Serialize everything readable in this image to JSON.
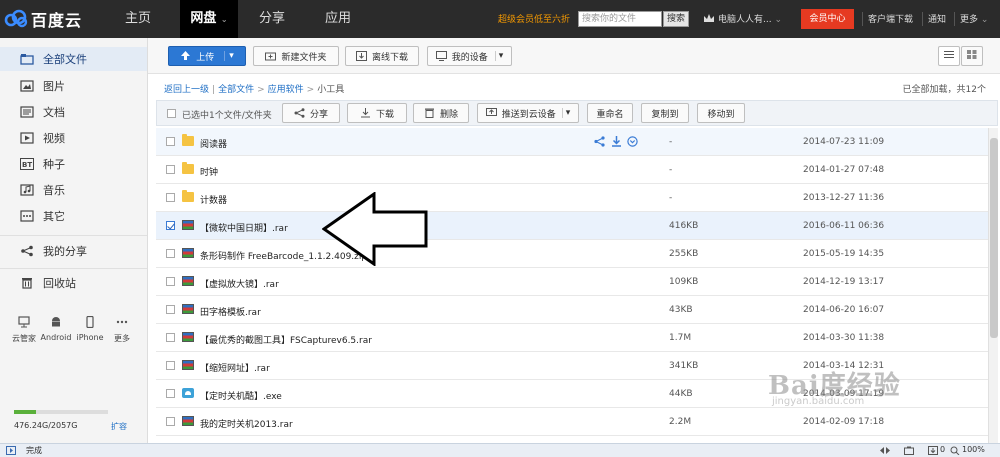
{
  "header": {
    "logo_text": "百度云",
    "nav": [
      {
        "label": "主页"
      },
      {
        "label": "网盘"
      },
      {
        "label": "分享"
      },
      {
        "label": "应用"
      }
    ],
    "promo_text": "超级会员低至六折",
    "search_placeholder": "搜索你的文件",
    "search_button": "搜索",
    "user_name": "电脑人人有...",
    "vip_button": "会员中心",
    "links": [
      "客户端下载",
      "通知",
      "更多"
    ]
  },
  "sidebar": {
    "items": [
      {
        "label": "全部文件",
        "icon": "folder-icon"
      },
      {
        "label": "图片",
        "icon": "image-icon"
      },
      {
        "label": "文档",
        "icon": "document-icon"
      },
      {
        "label": "视频",
        "icon": "video-icon"
      },
      {
        "label": "种子",
        "icon": "torrent-icon"
      },
      {
        "label": "音乐",
        "icon": "music-icon"
      },
      {
        "label": "其它",
        "icon": "more-icon"
      },
      {
        "label": "我的分享",
        "icon": "share-icon"
      },
      {
        "label": "回收站",
        "icon": "trash-icon"
      }
    ],
    "devices": [
      {
        "label": "云管家",
        "icon": "monitor-icon"
      },
      {
        "label": "Android",
        "icon": "android-icon"
      },
      {
        "label": "iPhone",
        "icon": "phone-icon"
      },
      {
        "label": "更多",
        "icon": "ellipsis-icon"
      }
    ],
    "quota_text": "476.24G/2057G",
    "quota_fraction": 0.23,
    "expand_label": "扩容"
  },
  "toolbar": {
    "upload": "上传",
    "new_folder": "新建文件夹",
    "offline": "离线下载",
    "my_devices": "我的设备"
  },
  "breadcrumb": {
    "back": "返回上一级",
    "items": [
      "全部文件",
      "应用软件",
      "小工具"
    ]
  },
  "loaded_text": "已全部加载，共12个",
  "actions": {
    "selected": "已选中1个文件/文件夹",
    "share": "分享",
    "download": "下载",
    "delete": "删除",
    "push": "推送到云设备",
    "rename": "重命名",
    "copy": "复制到",
    "move": "移动到"
  },
  "files": [
    {
      "name": "阅读器",
      "type": "folder",
      "size": "-",
      "date": "2014-07-23 11:09"
    },
    {
      "name": "时钟",
      "type": "folder",
      "size": "-",
      "date": "2014-01-27 07:48"
    },
    {
      "name": "计数器",
      "type": "folder",
      "size": "-",
      "date": "2013-12-27 11:36"
    },
    {
      "name": "【微软中国日期】.rar",
      "type": "rar",
      "size": "416KB",
      "date": "2016-06-11 06:36"
    },
    {
      "name": "条形码制作 FreeBarcode_1.1.2.409.zip",
      "type": "rar",
      "size": "255KB",
      "date": "2015-05-19 14:35"
    },
    {
      "name": "【虚拟放大镜】.rar",
      "type": "rar",
      "size": "109KB",
      "date": "2014-12-19 13:17"
    },
    {
      "name": "田字格模板.rar",
      "type": "rar",
      "size": "43KB",
      "date": "2014-06-20 16:07"
    },
    {
      "name": "【最优秀的截图工具】FSCapturev6.5.rar",
      "type": "rar",
      "size": "1.7M",
      "date": "2014-03-30 11:38"
    },
    {
      "name": "【缩短网址】.rar",
      "type": "rar",
      "size": "341KB",
      "date": "2014-03-14 12:31"
    },
    {
      "name": "【定时关机酷】.exe",
      "type": "exe",
      "size": "44KB",
      "date": "2014-03-09 17:19"
    },
    {
      "name": "我的定时关机2013.rar",
      "type": "rar",
      "size": "2.2M",
      "date": "2014-02-09 17:18"
    }
  ],
  "watermark": {
    "text": "Bai度经验",
    "sub": "jingyan.baidu.com"
  },
  "statusbar": {
    "text": "完成",
    "zoom": "100%",
    "count": "0"
  }
}
